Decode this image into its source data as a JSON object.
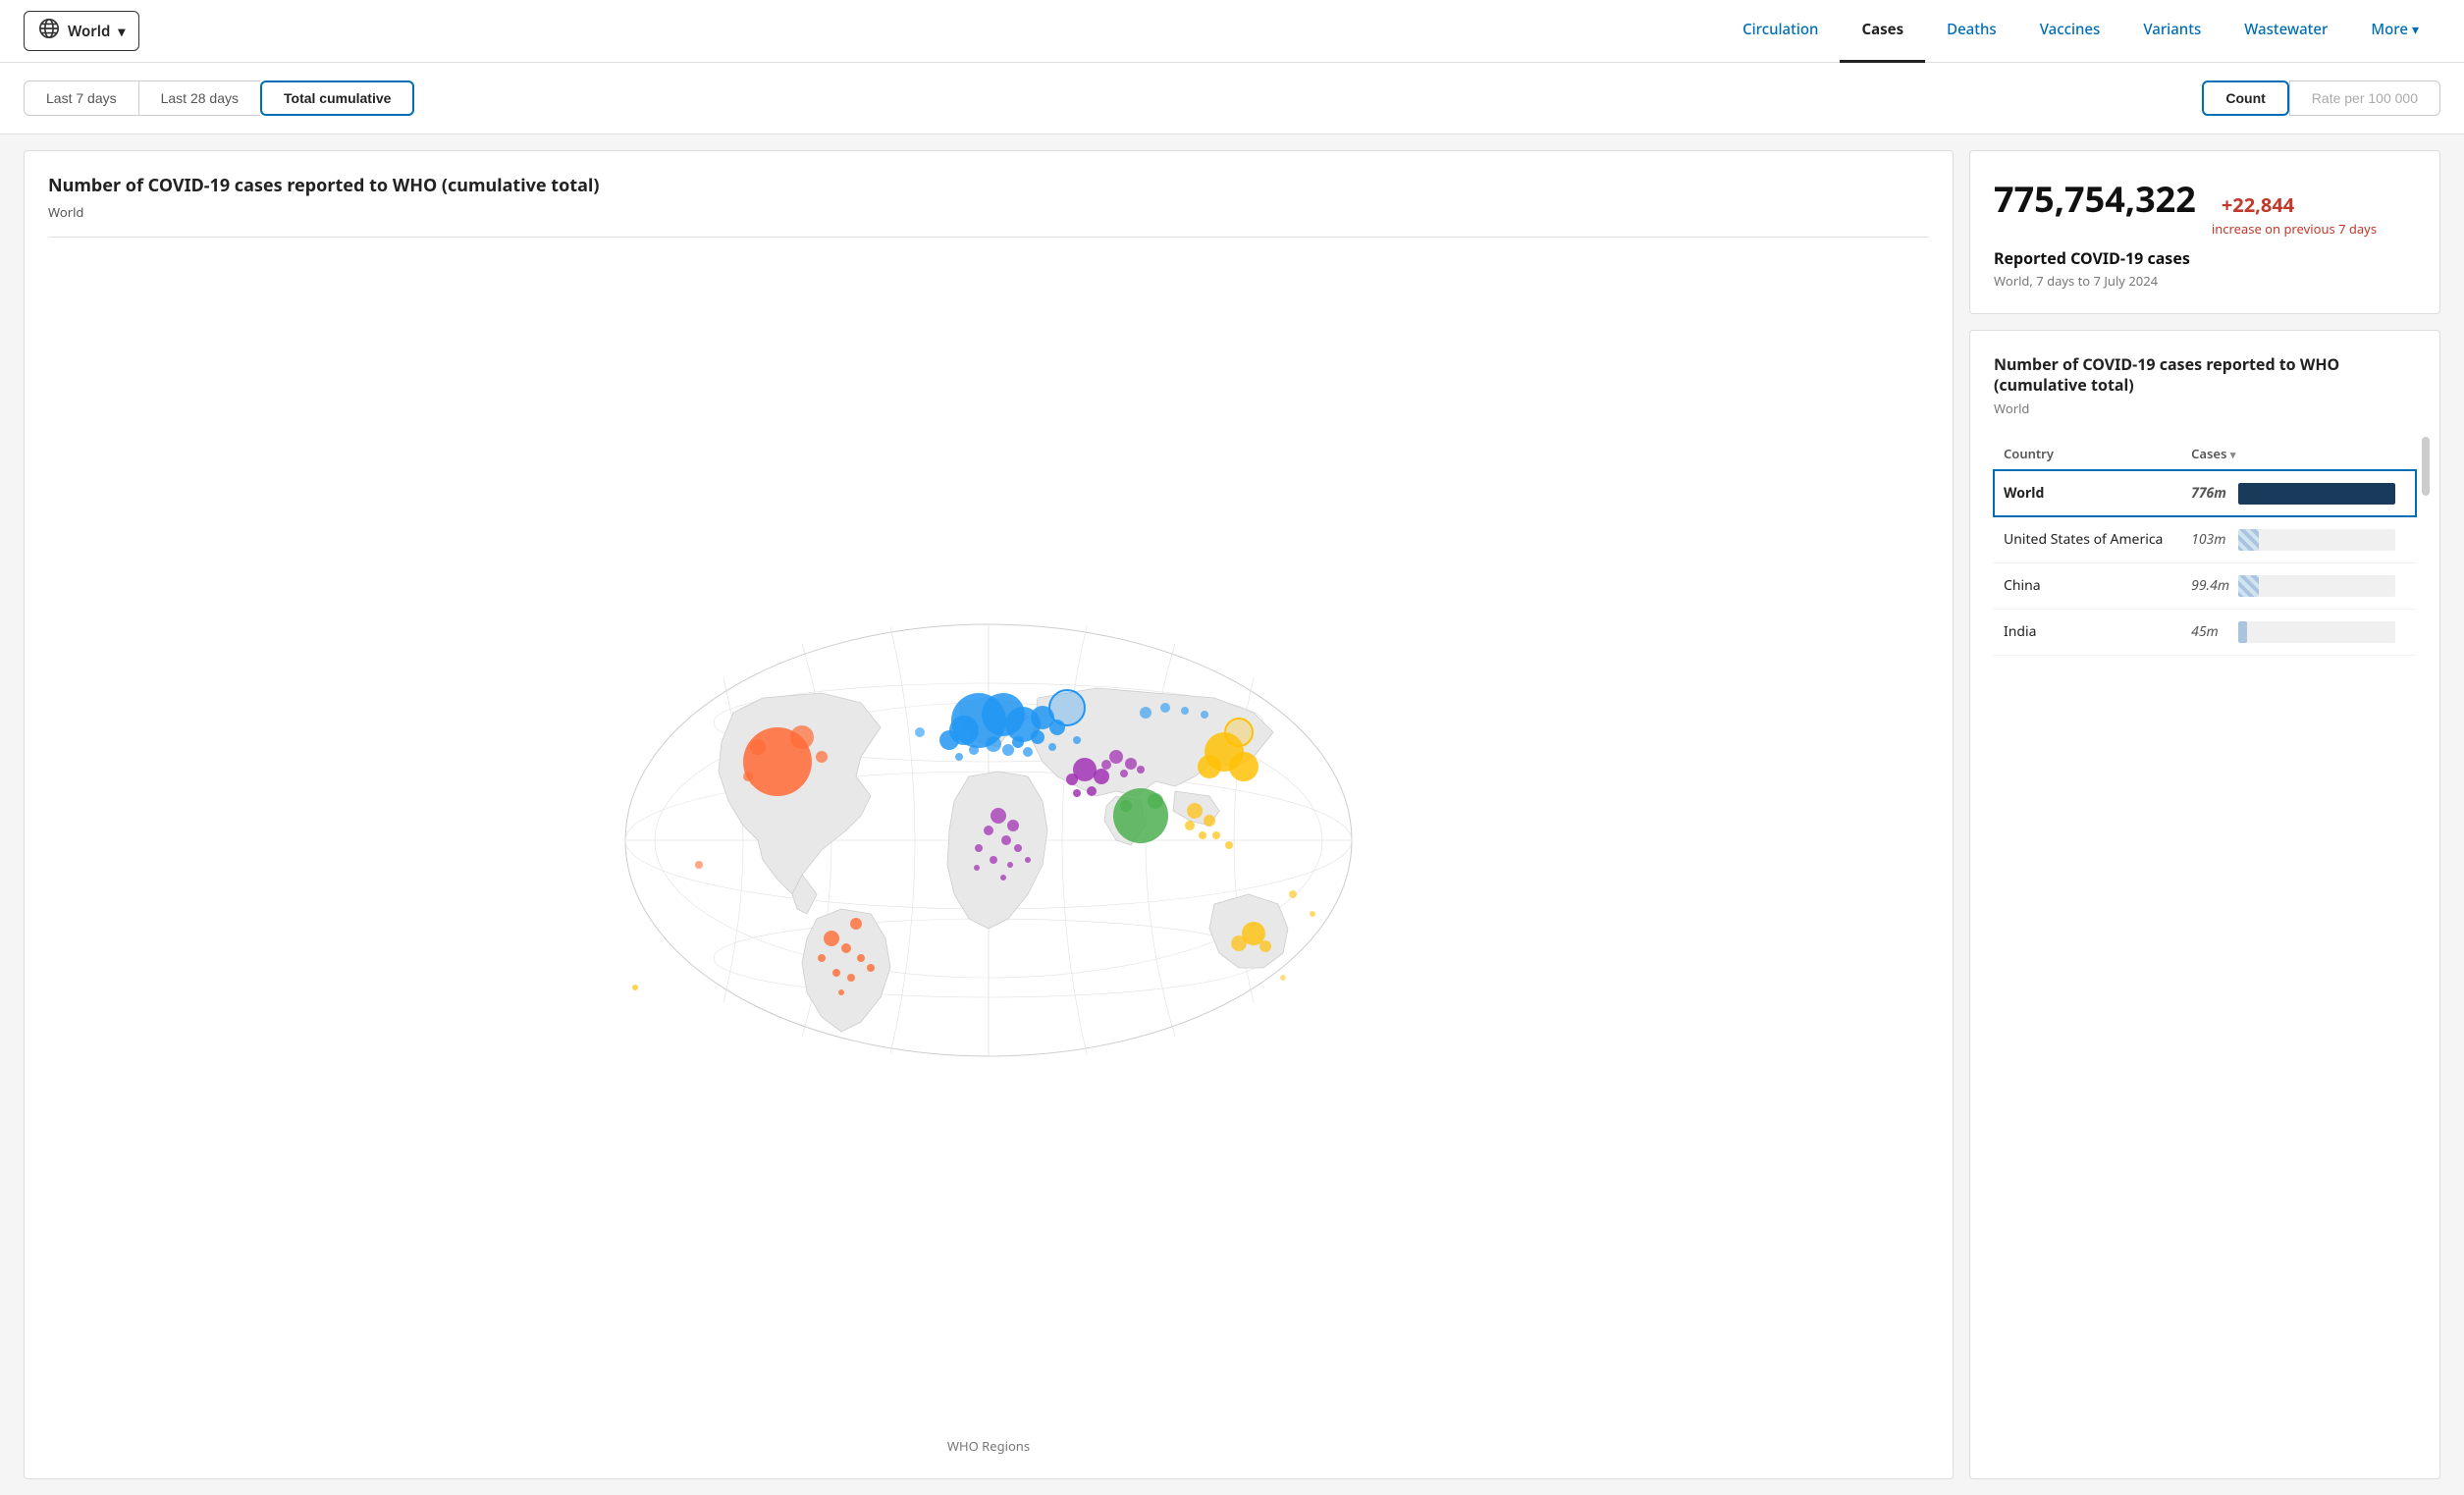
{
  "header": {
    "world_label": "World",
    "nav_items": [
      {
        "id": "circulation",
        "label": "Circulation",
        "active": false
      },
      {
        "id": "cases",
        "label": "Cases",
        "active": true
      },
      {
        "id": "deaths",
        "label": "Deaths",
        "active": false
      },
      {
        "id": "vaccines",
        "label": "Vaccines",
        "active": false
      },
      {
        "id": "variants",
        "label": "Variants",
        "active": false
      },
      {
        "id": "wastewater",
        "label": "Wastewater",
        "active": false
      },
      {
        "id": "more",
        "label": "More",
        "active": false
      }
    ]
  },
  "filter_bar": {
    "time_tabs": [
      {
        "id": "7days",
        "label": "Last 7 days",
        "active": false
      },
      {
        "id": "28days",
        "label": "Last 28 days",
        "active": false
      },
      {
        "id": "total",
        "label": "Total cumulative",
        "active": true
      }
    ],
    "rate_tabs": [
      {
        "id": "count",
        "label": "Count",
        "active": true
      },
      {
        "id": "rate",
        "label": "Rate per 100 000",
        "active": false
      }
    ]
  },
  "map_panel": {
    "title": "Number of COVID-19 cases reported to WHO (cumulative total)",
    "subtitle": "World",
    "legend_label": "WHO Regions"
  },
  "stats_card": {
    "total_number": "775,754,322",
    "increase_value": "+22,844",
    "increase_label": "increase on previous 7 days",
    "reported_label": "Reported COVID-19 cases",
    "period_label": "World, 7 days to 7 July 2024"
  },
  "table_card": {
    "title": "Number of COVID-19 cases reported to WHO (cumulative total)",
    "subtitle": "World",
    "col_country": "Country",
    "col_cases": "Cases",
    "rows": [
      {
        "id": "world",
        "country": "World",
        "cases": "776m",
        "bar_type": "world",
        "highlighted": true
      },
      {
        "id": "usa",
        "country": "United States of America",
        "cases": "103m",
        "bar_type": "usa",
        "highlighted": false
      },
      {
        "id": "china",
        "country": "China",
        "cases": "99.4m",
        "bar_type": "china",
        "highlighted": false
      },
      {
        "id": "india",
        "country": "India",
        "cases": "45m",
        "bar_type": "india",
        "highlighted": false
      }
    ]
  }
}
